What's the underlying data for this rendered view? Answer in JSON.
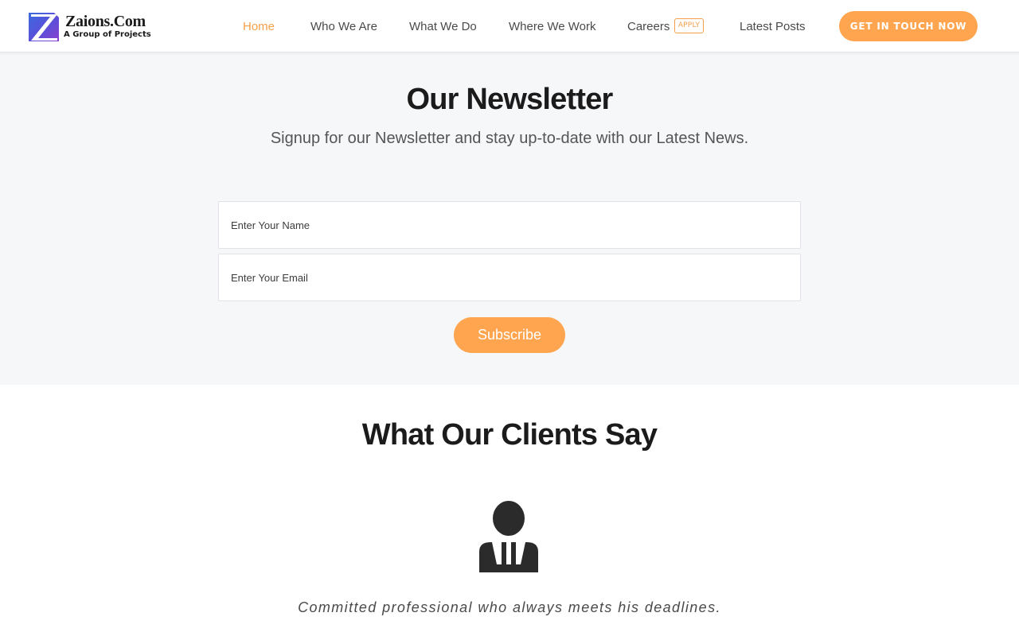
{
  "header": {
    "logo_name": "Zaions.Com",
    "logo_tagline": "A Group of Projects",
    "nav": [
      {
        "label": "Home",
        "active": true
      },
      {
        "label": "Who We Are",
        "active": false
      },
      {
        "label": "What We Do",
        "active": false
      },
      {
        "label": "Where We Work",
        "active": false
      },
      {
        "label": "Careers",
        "active": false,
        "badge": "APPLY"
      },
      {
        "label": "Latest Posts",
        "active": false
      }
    ],
    "cta_label": "GET IN TOUCH NOW"
  },
  "newsletter": {
    "title": "Our Newsletter",
    "subtitle": "Signup for our Newsletter and stay up-to-date with our Latest News.",
    "name_placeholder": "Enter Your Name",
    "name_value": "",
    "email_placeholder": "Enter Your Email",
    "email_value": "",
    "subscribe_label": "Subscribe"
  },
  "testimonials": {
    "title": "What Our Clients Say",
    "quote": "Committed professional who always meets his deadlines.",
    "avatar_icon": "user-silhouette-icon"
  },
  "colors": {
    "accent": "#ffa54f",
    "active_nav": "#f5a04a",
    "section_bg": "#f6f7f9",
    "heading": "#1b1b1b"
  }
}
